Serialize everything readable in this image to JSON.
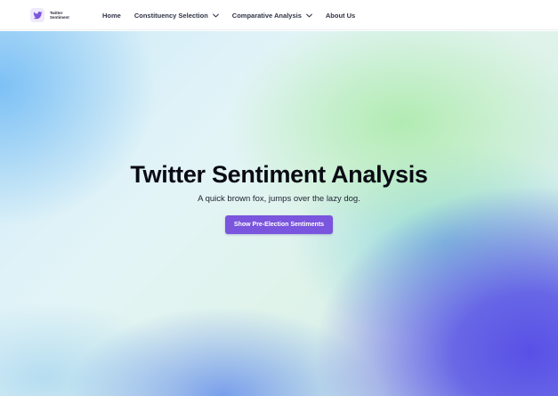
{
  "brand": {
    "name_line1": "Twitter",
    "name_line2": "Sentiment",
    "icon": "twitter-bird-icon",
    "icon_color": "#7a55dd"
  },
  "nav": {
    "items": [
      {
        "label": "Home",
        "has_dropdown": false
      },
      {
        "label": "Constituency Selection",
        "has_dropdown": true
      },
      {
        "label": "Comparative Analysis",
        "has_dropdown": true
      },
      {
        "label": "About Us",
        "has_dropdown": false
      }
    ]
  },
  "hero": {
    "title": "Twitter Sentiment Analysis",
    "subtitle": "A quick brown fox, jumps over the lazy dog.",
    "cta_label": "Show Pre-Election Sentiments",
    "cta_color": "#7a55dd"
  }
}
